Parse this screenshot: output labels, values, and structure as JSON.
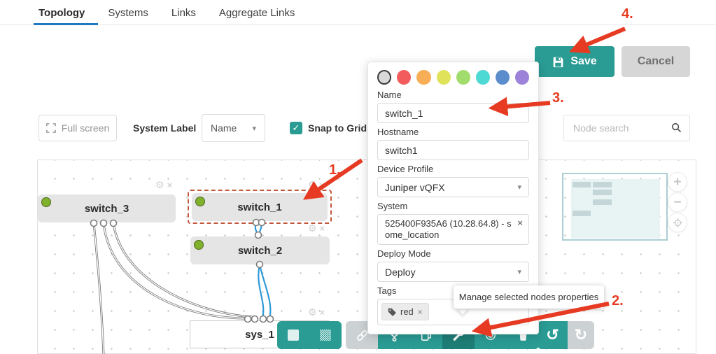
{
  "tabs": [
    {
      "label": "Topology",
      "active": true
    },
    {
      "label": "Systems",
      "active": false
    },
    {
      "label": "Links",
      "active": false
    },
    {
      "label": "Aggregate Links",
      "active": false
    }
  ],
  "actions": {
    "save": "Save",
    "cancel": "Cancel"
  },
  "controls": {
    "full_screen": "Full screen",
    "system_label": "System Label",
    "system_label_value": "Name",
    "snap_to_grid": "Snap to Grid",
    "node_search_placeholder": "Node search"
  },
  "panel": {
    "colors": [
      "#d9d9d9",
      "#f25c5c",
      "#f8ae56",
      "#e0e35a",
      "#a2dc6c",
      "#4ed9d4",
      "#5b8ccc",
      "#9c82d9"
    ],
    "selected_color_index": 0,
    "name": {
      "label": "Name",
      "value": "switch_1"
    },
    "hostname": {
      "label": "Hostname",
      "value": "switch1"
    },
    "device_profile": {
      "label": "Device Profile",
      "value": "Juniper vQFX"
    },
    "system": {
      "label": "System",
      "value": "525400F935A6 (10.28.64.8) - some_location"
    },
    "deploy_mode": {
      "label": "Deploy Mode",
      "value": "Deploy"
    },
    "tags": {
      "label": "Tags",
      "chips": [
        "red"
      ]
    }
  },
  "canvas": {
    "nodes": [
      {
        "label": "switch_3",
        "selected": false
      },
      {
        "label": "switch_1",
        "selected": true
      },
      {
        "label": "switch_2",
        "selected": false
      },
      {
        "label": "sys_1",
        "selected": false
      }
    ]
  },
  "tooltip": {
    "text": "Manage selected nodes properties"
  },
  "annotations": {
    "steps": [
      "1.",
      "2.",
      "3.",
      "4."
    ]
  },
  "icons": {
    "gear": "⚙",
    "close": "×",
    "undo": "↺",
    "redo": "↻",
    "caret": "▾",
    "check": "✓",
    "plus": "+",
    "minus": "−"
  },
  "colors": {
    "accent_teal": "#2a9c94",
    "accent_teal_dark": "#1e7e77",
    "disabled_gray": "#ccd2d4",
    "arrow_red": "#e63b22",
    "selection_dash": "#c2573d",
    "status_green": "#7fb12c",
    "link_blue": "#2e9ad7",
    "tab_underline": "#2079c3"
  }
}
